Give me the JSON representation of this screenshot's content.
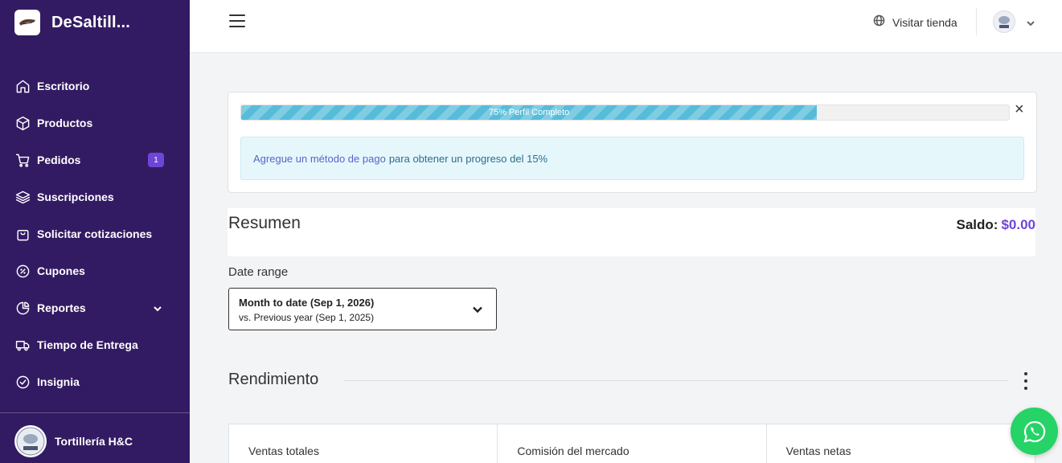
{
  "brand": {
    "name": "DeSaltill..."
  },
  "sidebar": {
    "items": [
      {
        "label": "Escritorio",
        "icon": "home-icon"
      },
      {
        "label": "Productos",
        "icon": "box-icon"
      },
      {
        "label": "Pedidos",
        "icon": "cart-icon",
        "badge": "1"
      },
      {
        "label": "Suscripciones",
        "icon": "layers-icon"
      },
      {
        "label": "Solicitar cotizaciones",
        "icon": "shopping-bag-icon"
      },
      {
        "label": "Cupones",
        "icon": "percent-icon"
      },
      {
        "label": "Reportes",
        "icon": "pie-chart-icon"
      },
      {
        "label": "Tiempo de Entrega",
        "icon": "truck-icon"
      },
      {
        "label": "Insignia",
        "icon": "check-circle-icon"
      }
    ],
    "store_name": "Tortillería H&C"
  },
  "topbar": {
    "visit_store": "Visitar tienda"
  },
  "progress": {
    "percent": 75,
    "label": "75% Perfil Completo",
    "alert_link": "Agregue un método de pago",
    "alert_text": "para obtener un progreso del 15%"
  },
  "summary": {
    "title": "Resumen",
    "balance_label": "Saldo:",
    "balance_value": "$0.00"
  },
  "date_range": {
    "label": "Date range",
    "main": "Month to date (Sep 1, 2026)",
    "compare": "vs. Previous year (Sep 1, 2025)"
  },
  "performance": {
    "title": "Rendimiento",
    "kpis": [
      "Ventas totales",
      "Comisión del mercado",
      "Ventas netas"
    ]
  },
  "colors": {
    "sidebar": "#331b63",
    "accent": "#6f45d8",
    "progress": "#56bcda",
    "whatsapp": "#25d366"
  }
}
